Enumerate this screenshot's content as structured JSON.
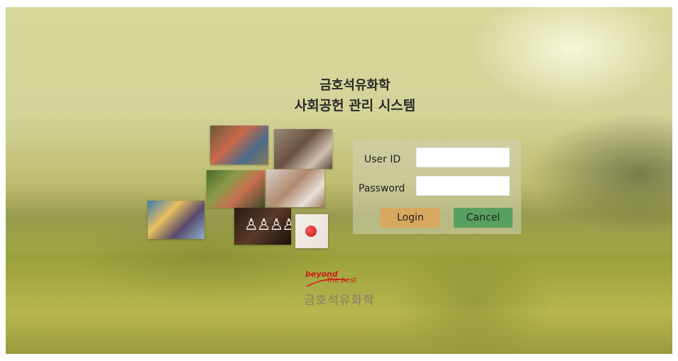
{
  "header": {
    "title_line1": "금호석유화학",
    "title_line2": "사회공헌 관리 시스템"
  },
  "login": {
    "user_id_label": "User ID",
    "password_label": "Password",
    "user_id_value": "",
    "password_value": "",
    "login_label": "Login",
    "cancel_label": "Cancel",
    "login_color": "#d9a860",
    "cancel_color": "#58a060"
  },
  "logo": {
    "tagline_1": "beyond",
    "tagline_2": "the best",
    "company": "금호석유화학",
    "brand_color": "#d01818"
  },
  "collage": {
    "icons": [
      "family-silhouette-icon",
      "red-apple-icon"
    ]
  }
}
